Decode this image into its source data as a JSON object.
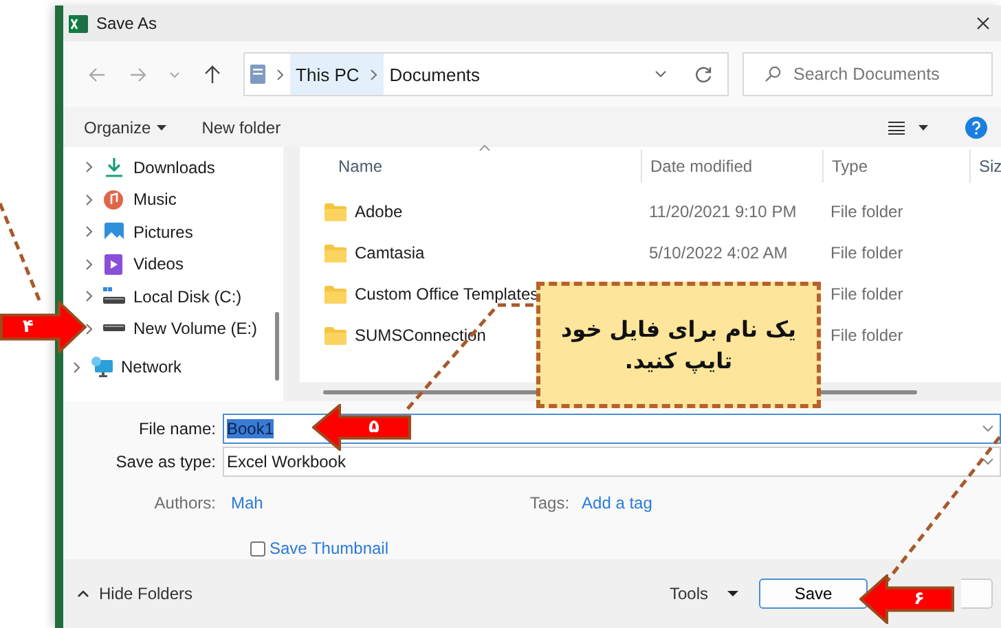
{
  "window": {
    "title": "Save As"
  },
  "address": {
    "segments": [
      "This PC",
      "Documents"
    ]
  },
  "search": {
    "placeholder": "Search Documents"
  },
  "toolbar": {
    "organize": "Organize",
    "new_folder": "New folder"
  },
  "sidebar": {
    "items": [
      {
        "label": "Downloads",
        "kind": "downloads"
      },
      {
        "label": "Music",
        "kind": "music"
      },
      {
        "label": "Pictures",
        "kind": "pictures"
      },
      {
        "label": "Videos",
        "kind": "videos"
      },
      {
        "label": "Local Disk (C:)",
        "kind": "system-drive"
      },
      {
        "label": "New Volume (E:)",
        "kind": "drive"
      },
      {
        "label": "Network",
        "kind": "network"
      }
    ]
  },
  "table": {
    "columns": [
      "Name",
      "Date modified",
      "Type",
      "Siz"
    ],
    "rows": [
      {
        "name": "Adobe",
        "date_modified": "11/20/2021 9:10 PM",
        "type": "File folder"
      },
      {
        "name": "Camtasia",
        "date_modified": "5/10/2022 4:02 AM",
        "type": "File folder"
      },
      {
        "name": "Custom Office Templates",
        "type": "File folder"
      },
      {
        "name": "SUMSConnection",
        "type": "File folder"
      }
    ]
  },
  "form": {
    "file_name": {
      "label": "File name:",
      "value": "Book1",
      "text_selected": true
    },
    "save_as_type": {
      "label": "Save as type:",
      "value": "Excel Workbook"
    },
    "authors": {
      "label": "Authors:",
      "value": "Mah"
    },
    "tags": {
      "label": "Tags:",
      "value": "Add a tag"
    },
    "save_thumbnail": {
      "label": "Save Thumbnail",
      "checked": false
    }
  },
  "footer": {
    "hide_folders": "Hide Folders",
    "tools": "Tools",
    "save": "Save"
  },
  "annotations": {
    "arrows": [
      {
        "number": "۴",
        "kind": "pointing-right"
      },
      {
        "number": "۵",
        "kind": "pointing-left"
      },
      {
        "number": "۶",
        "kind": "pointing-left"
      }
    ],
    "callout": "یک نام برای فایل خود تایپ کنید."
  }
}
